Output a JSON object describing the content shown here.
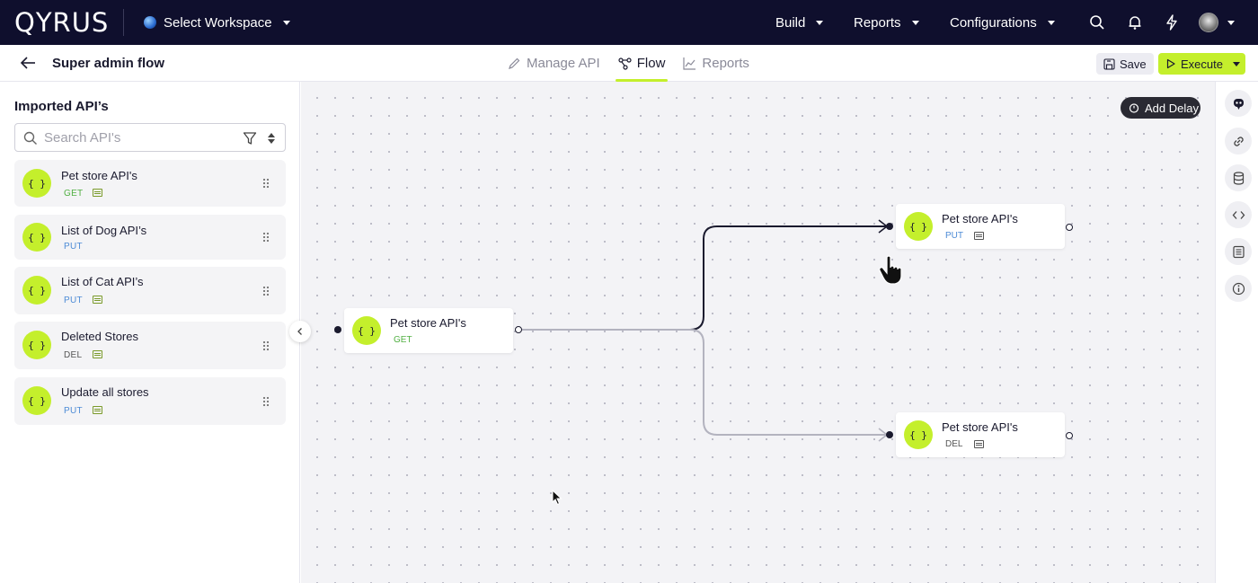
{
  "brand": {
    "logo_text": "QYRUS",
    "accent": "#c4ef2c",
    "nav_bg": "#0f0f2d"
  },
  "topnav": {
    "workspace_label": "Select Workspace",
    "menus": [
      {
        "label": "Build"
      },
      {
        "label": "Reports"
      },
      {
        "label": "Configurations"
      }
    ],
    "icons": [
      "search-icon",
      "bell-icon",
      "lightning-icon",
      "avatar"
    ]
  },
  "subheader": {
    "title": "Super admin flow",
    "tabs": [
      {
        "label": "Manage API",
        "icon": "pencil-icon",
        "active": false
      },
      {
        "label": "Flow",
        "icon": "flow-icon",
        "active": true
      },
      {
        "label": "Reports",
        "icon": "chart-icon",
        "active": false
      }
    ],
    "save_label": "Save",
    "execute_label": "Execute"
  },
  "left_panel": {
    "title": "Imported API’s",
    "search_placeholder": "Search API's",
    "items": [
      {
        "name": "Pet store API's",
        "method": "GET"
      },
      {
        "name": "List of Dog API’s",
        "method": "PUT"
      },
      {
        "name": "List of Cat API’s",
        "method": "PUT"
      },
      {
        "name": "Deleted Stores",
        "method": "DEL"
      },
      {
        "name": "Update all stores",
        "method": "PUT"
      }
    ]
  },
  "canvas": {
    "add_delay_label": "Add Delay",
    "nodes": [
      {
        "name": "Pet store API's",
        "method": "GET"
      },
      {
        "name": "Pet store API's",
        "method": "PUT"
      },
      {
        "name": "Pet store API's",
        "method": "DEL"
      }
    ]
  },
  "right_rail": {
    "icons": [
      "robot-icon",
      "link-icon",
      "database-icon",
      "code-icon",
      "list-icon",
      "info-icon"
    ]
  }
}
